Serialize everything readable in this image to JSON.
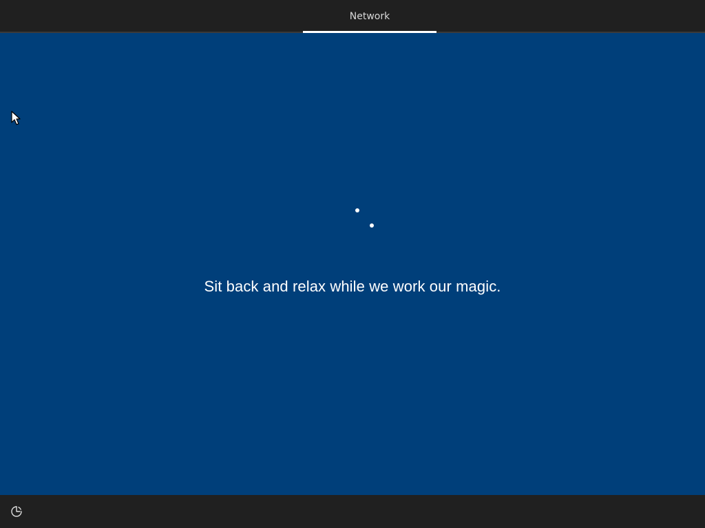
{
  "header": {
    "active_tab_label": "Network"
  },
  "main": {
    "status_message": "Sit back and relax while we work our magic."
  },
  "footer": {
    "ease_of_access_icon": "ease-of-access-icon"
  },
  "colors": {
    "background": "#003f7a",
    "bar_background": "#202020",
    "accent_indicator": "#ffffff",
    "text": "#ffffff"
  },
  "icons": {
    "cursor": "mouse-pointer-icon",
    "spinner": "loading-spinner-icon"
  }
}
